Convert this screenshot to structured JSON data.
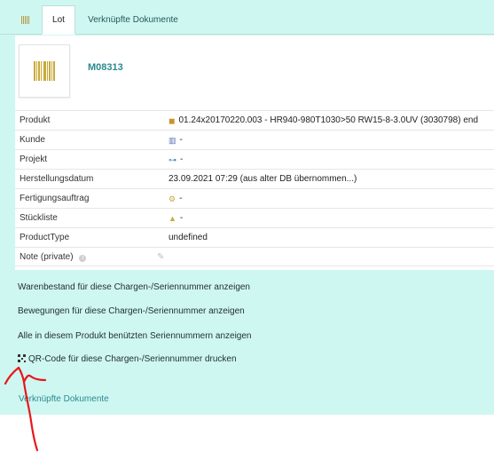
{
  "tabs": {
    "icon_name": "barcode-icon",
    "lot": "Lot",
    "documents": "Verknüpfte Dokumente"
  },
  "header": {
    "image_icon": "barcode-image",
    "lot_number": "M08313"
  },
  "fields": [
    {
      "label": "Produkt",
      "icon": "box-icon",
      "value": "01.24x20170220.003 - HR940-980T1030>50 RW15-8-3.0UV (3030798) end"
    },
    {
      "label": "Kunde",
      "icon": "building-icon",
      "value": "-"
    },
    {
      "label": "Projekt",
      "icon": "project-icon",
      "value": "-"
    },
    {
      "label": "Herstellungsdatum",
      "icon": "",
      "value": "23.09.2021 07:29 (aus alter DB übernommen...)"
    },
    {
      "label": "Fertigungsauftrag",
      "icon": "production-order-icon",
      "value": "-"
    },
    {
      "label": "Stückliste",
      "icon": "parts-list-icon",
      "value": "-"
    },
    {
      "label": "ProductType",
      "icon": "",
      "value": "undefined"
    },
    {
      "label": "Note (private)",
      "icon": "info-icon",
      "value": ""
    }
  ],
  "actions": {
    "stock": "Warenbestand für diese Chargen-/Seriennummer anzeigen",
    "movements": "Bewegungen für diese Chargen-/Seriennummer anzeigen",
    "serials": "Alle in diesem Produkt benützten Seriennummern anzeigen",
    "qr_print": "QR-Code für diese Chargen-/Seriennummer drucken"
  },
  "footer": {
    "documents_link": "Verknüpfte Dokumente"
  },
  "colors": {
    "panel_bg": "#cff7f1",
    "accent_teal": "#2a8a8f",
    "annotation_red": "#e8171c"
  }
}
